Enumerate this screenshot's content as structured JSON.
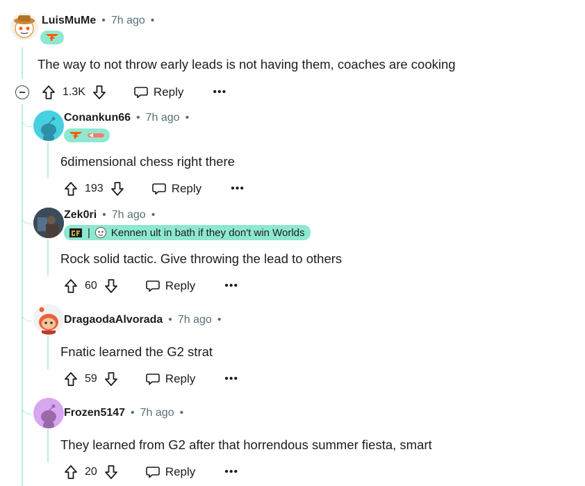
{
  "comments": [
    {
      "username": "LuisMuMe",
      "time": "7h ago",
      "separator": "•",
      "flair_text": "",
      "body": "The way to not throw early leads is not having them, coaches are cooking",
      "votes": "1.3K",
      "reply_label": "Reply",
      "more_label": "•••",
      "avatar_color": "#f8efe4"
    },
    {
      "username": "Conankun66",
      "time": "7h ago",
      "separator": "•",
      "flair_text": "",
      "body": "6dimensional chess right there",
      "votes": "193",
      "reply_label": "Reply",
      "more_label": "•••",
      "avatar_color": "#46d1e0"
    },
    {
      "username": "Zek0ri",
      "time": "7h ago",
      "separator": "•",
      "flair_text": "Kennen ult in bath if they don't win Worlds",
      "flair_divider": "|",
      "body": "Rock solid tactic. Give throwing the lead to others",
      "votes": "60",
      "reply_label": "Reply",
      "more_label": "•••",
      "avatar_color": "#2a3a4a"
    },
    {
      "username": "DragaodaAlvorada",
      "time": "7h ago",
      "separator": "•",
      "flair_text": "",
      "body": "Fnatic learned the G2 strat",
      "votes": "59",
      "reply_label": "Reply",
      "more_label": "•••",
      "avatar_color": "#e8623a"
    },
    {
      "username": "Frozen5147",
      "time": "7h ago",
      "separator": "•",
      "flair_text": "",
      "body": "They learned from G2 after that horrendous summer fiesta, smart",
      "votes": "20",
      "reply_label": "Reply",
      "more_label": "•••",
      "avatar_color": "#d7a6f0"
    }
  ],
  "colors": {
    "thread_line": "#b7f0de",
    "flair_bg": "#8ee8d1",
    "fnatic_orange": "#ff5900",
    "meta_gray": "#576f76"
  }
}
